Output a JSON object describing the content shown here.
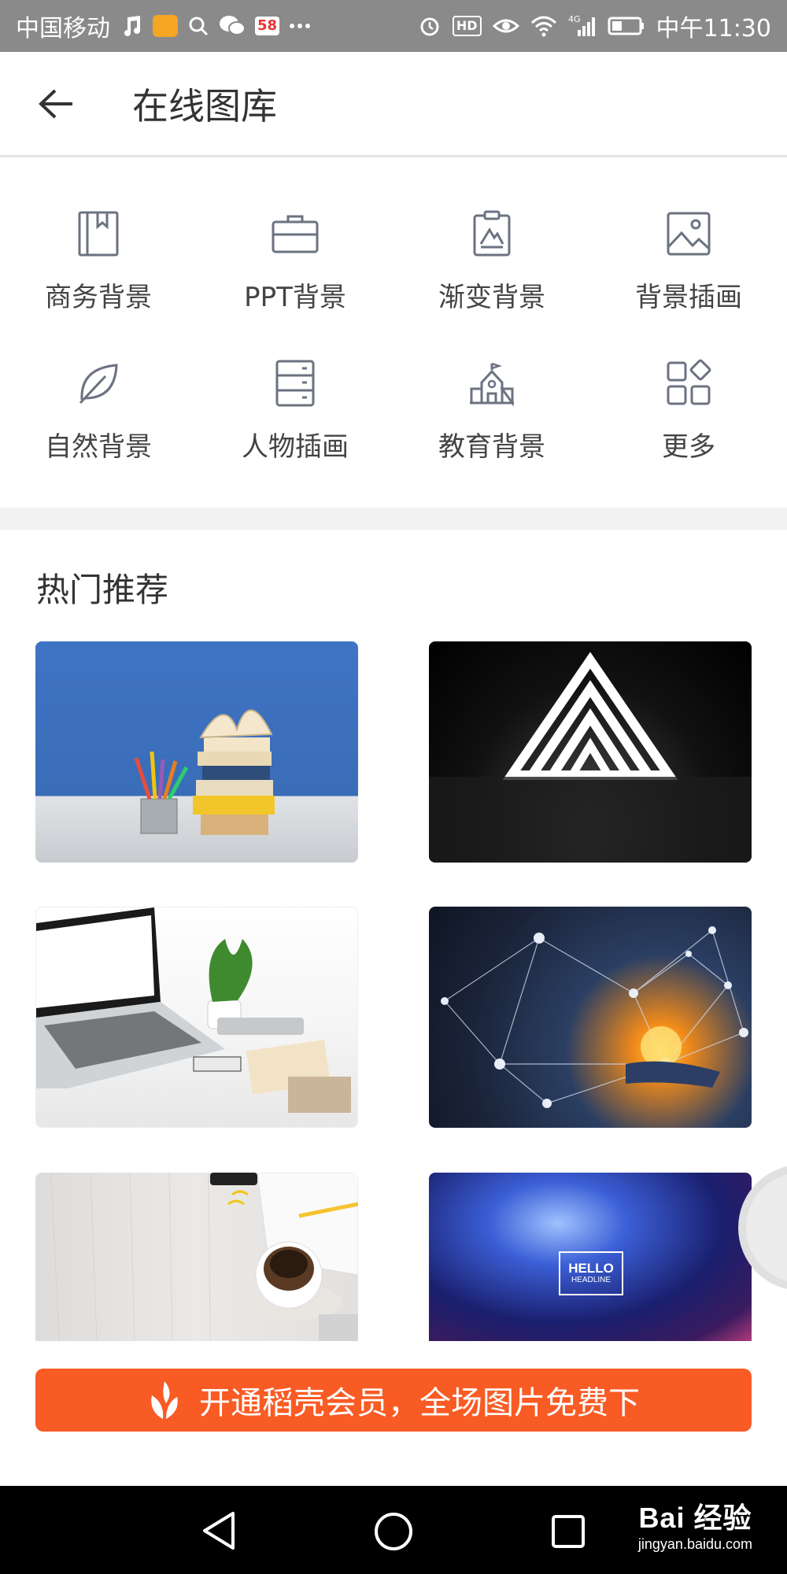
{
  "status_bar": {
    "carrier": "中国移动",
    "badge_hd": "HD",
    "badge_58": "58",
    "signal": "4G",
    "time": "中午11:30",
    "icons": [
      "music-icon",
      "weibo-icon",
      "search-icon",
      "wechat-icon",
      "app58-icon",
      "more-dots-icon",
      "alarm-icon",
      "hd-icon",
      "eye-icon",
      "wifi-icon",
      "signal-icon",
      "battery-icon"
    ]
  },
  "header": {
    "title": "在线图库",
    "back_icon": "arrow-left-icon"
  },
  "categories": [
    {
      "label": "商务背景",
      "icon": "book-icon"
    },
    {
      "label": "PPT背景",
      "icon": "briefcase-icon"
    },
    {
      "label": "渐变背景",
      "icon": "clipboard-mountain-icon"
    },
    {
      "label": "背景插画",
      "icon": "image-icon"
    },
    {
      "label": "自然背景",
      "icon": "leaf-icon"
    },
    {
      "label": "人物插画",
      "icon": "cabinet-icon"
    },
    {
      "label": "教育背景",
      "icon": "school-icon"
    },
    {
      "label": "更多",
      "icon": "grid-more-icon"
    }
  ],
  "section": {
    "title": "热门推荐"
  },
  "thumbnails": {
    "hello_title": "HELLO",
    "hello_sub": "HEADLINE"
  },
  "promo": {
    "label": "开通稻壳会员，全场图片免费下",
    "icon": "docer-leaf-icon",
    "color": "#f95b24"
  },
  "navbar": {
    "icons": [
      "nav-back-icon",
      "nav-home-icon",
      "nav-recent-icon"
    ]
  },
  "watermark": {
    "line1": "Bai 经验",
    "line2": "jingyan.baidu.com"
  }
}
